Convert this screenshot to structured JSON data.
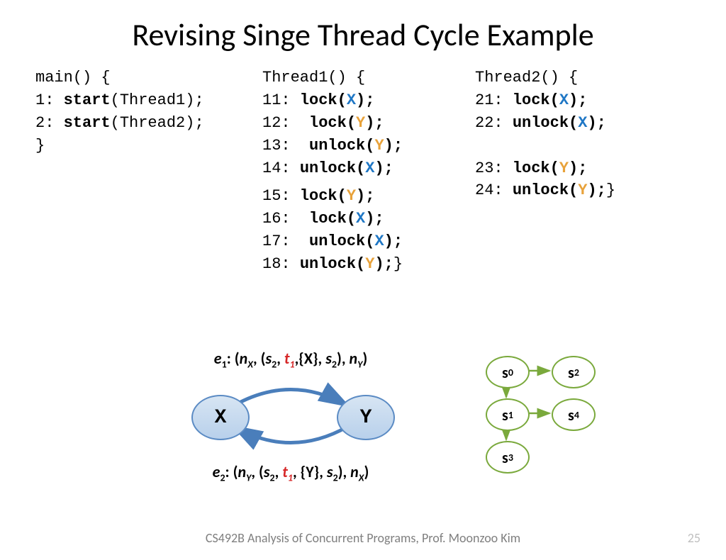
{
  "title": "Revising Singe Thread Cycle Example",
  "main": {
    "l0": "main() {",
    "l1a": "1: ",
    "l1b": "start",
    "l1c": "(Thread1);",
    "l2a": "2: ",
    "l2b": "start",
    "l2c": "(Thread2);",
    "l3": "}"
  },
  "t1": {
    "head": "Thread1() {",
    "l11a": "11: ",
    "l11b": "lock(",
    "l11x": "X",
    "l11c": ");",
    "l12a": "12:  ",
    "l12b": "lock(",
    "l12y": "Y",
    "l12c": ");",
    "l13a": "13:  ",
    "l13b": "unlock(",
    "l13y": "Y",
    "l13c": ");",
    "l14a": "14: ",
    "l14b": "unlock(",
    "l14x": "X",
    "l14c": ");",
    "l15a": "15: ",
    "l15b": "lock(",
    "l15y": "Y",
    "l15c": ");",
    "l16a": "16:  ",
    "l16b": "lock(",
    "l16x": "X",
    "l16c": ");",
    "l17a": "17:  ",
    "l17b": "unlock(",
    "l17x": "X",
    "l17c": ");",
    "l18a": "18: ",
    "l18b": "unlock(",
    "l18y": "Y",
    "l18c": ");",
    "l18d": "}"
  },
  "t2": {
    "head": "Thread2() {",
    "l21a": "21: ",
    "l21b": "lock(",
    "l21x": "X",
    "l21c": ");",
    "l22a": "22: ",
    "l22b": "unlock(",
    "l22x": "X",
    "l22c": ");",
    "l23a": "23: ",
    "l23b": "lock(",
    "l23y": "Y",
    "l23c": ");",
    "l24a": "24: ",
    "l24b": "unlock(",
    "l24y": "Y",
    "l24c": ");",
    "l24d": "}"
  },
  "edge1": {
    "e": "e",
    "esub": "1",
    "open": ": (",
    "n1": "n",
    "n1sub": "X",
    "c1": ", (",
    "s1": "s",
    "s1sub": "2",
    "c2": ", ",
    "t": "t",
    "tsub": "1",
    "c3": ",{X}, ",
    "s2": "s",
    "s2sub": "2",
    "c4": "), ",
    "n2": "n",
    "n2sub": "Y",
    "close": ")"
  },
  "edge2": {
    "e": "e",
    "esub": "2",
    "open": ": (",
    "n1": "n",
    "n1sub": "Y",
    "c1": ", (",
    "s1": "s",
    "s1sub": "2",
    "c2": ", ",
    "t": "t",
    "tsub": "1",
    "c3": ", {Y}, ",
    "s2": "s",
    "s2sub": "2",
    "c4": "), ",
    "n2": "n",
    "n2sub": "X",
    "close": ")"
  },
  "nodes": {
    "x": "X",
    "y": "Y"
  },
  "states": {
    "s0": "s",
    "s0s": "0",
    "s1": "s",
    "s1s": "1",
    "s2": "s",
    "s2s": "2",
    "s3": "s",
    "s3s": "3",
    "s4": "s",
    "s4s": "4"
  },
  "footer": "CS492B Analysis of Concurrent Programs, Prof. Moonzoo Kim",
  "page": "25"
}
